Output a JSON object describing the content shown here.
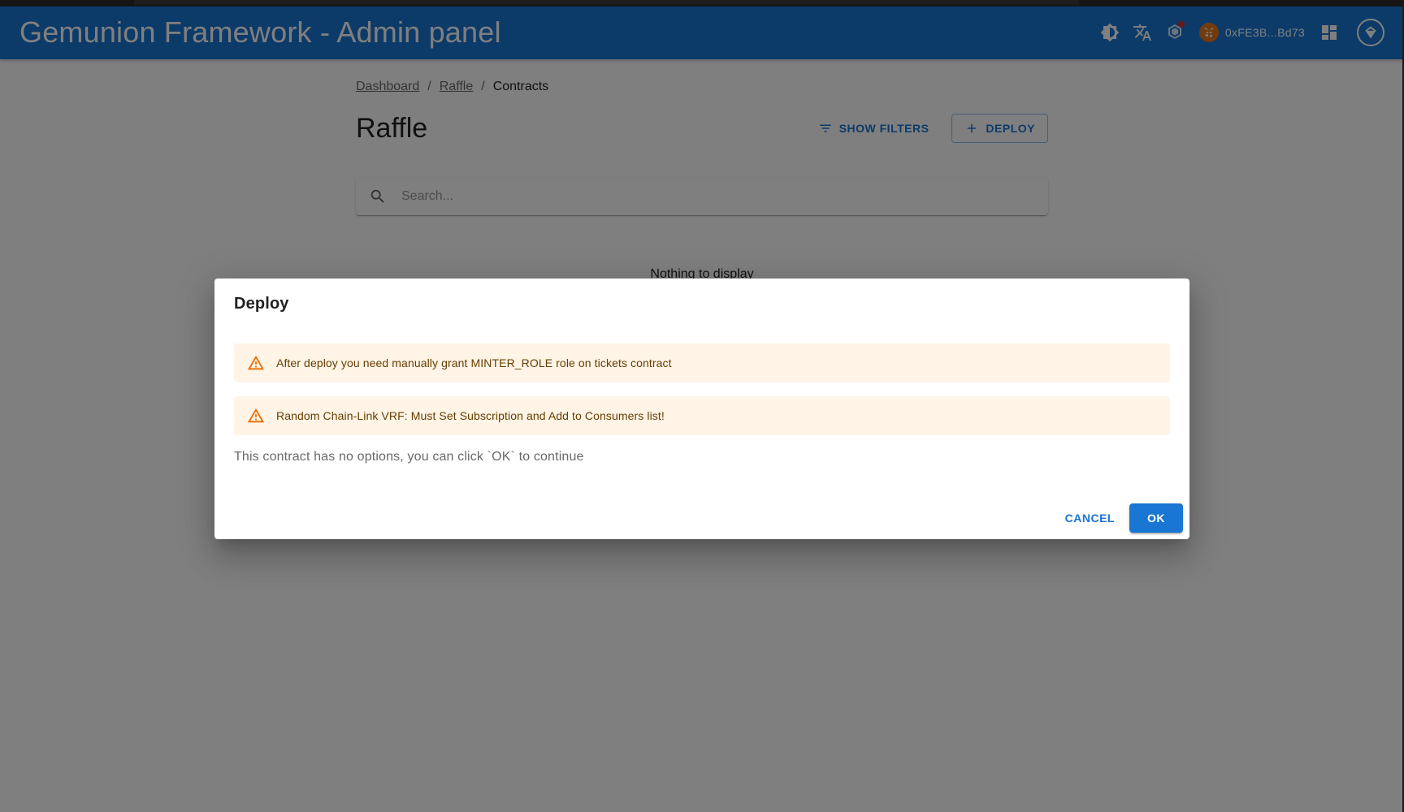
{
  "app": {
    "title": "Gemunion Framework - Admin panel",
    "wallet_address": "0xFE3B...Bd73",
    "accent_color": "#1976d2"
  },
  "icons": {
    "theme": "brightness-icon",
    "language": "translate-icon",
    "network": "network-icon",
    "wallet": "metamask-fox-icon",
    "dashboard": "dashboard-icon",
    "logo": "gemunion-logo-icon"
  },
  "breadcrumb": {
    "items": [
      "Dashboard",
      "Raffle",
      "Contracts"
    ],
    "separator": "/"
  },
  "page": {
    "title": "Raffle",
    "show_filters_label": "SHOW FILTERS",
    "deploy_label": "DEPLOY",
    "search_placeholder": "Search...",
    "empty_text": "Nothing to display"
  },
  "dialog": {
    "title": "Deploy",
    "alerts": [
      "After deploy you need manually grant MINTER_ROLE role on tickets contract",
      "Random Chain-Link VRF: Must Set Subscription and Add to Consumers list!"
    ],
    "body": "This contract has no options, you can click `OK` to continue",
    "cancel_label": "CANCEL",
    "ok_label": "OK",
    "alert_color": "#ed6c02"
  }
}
